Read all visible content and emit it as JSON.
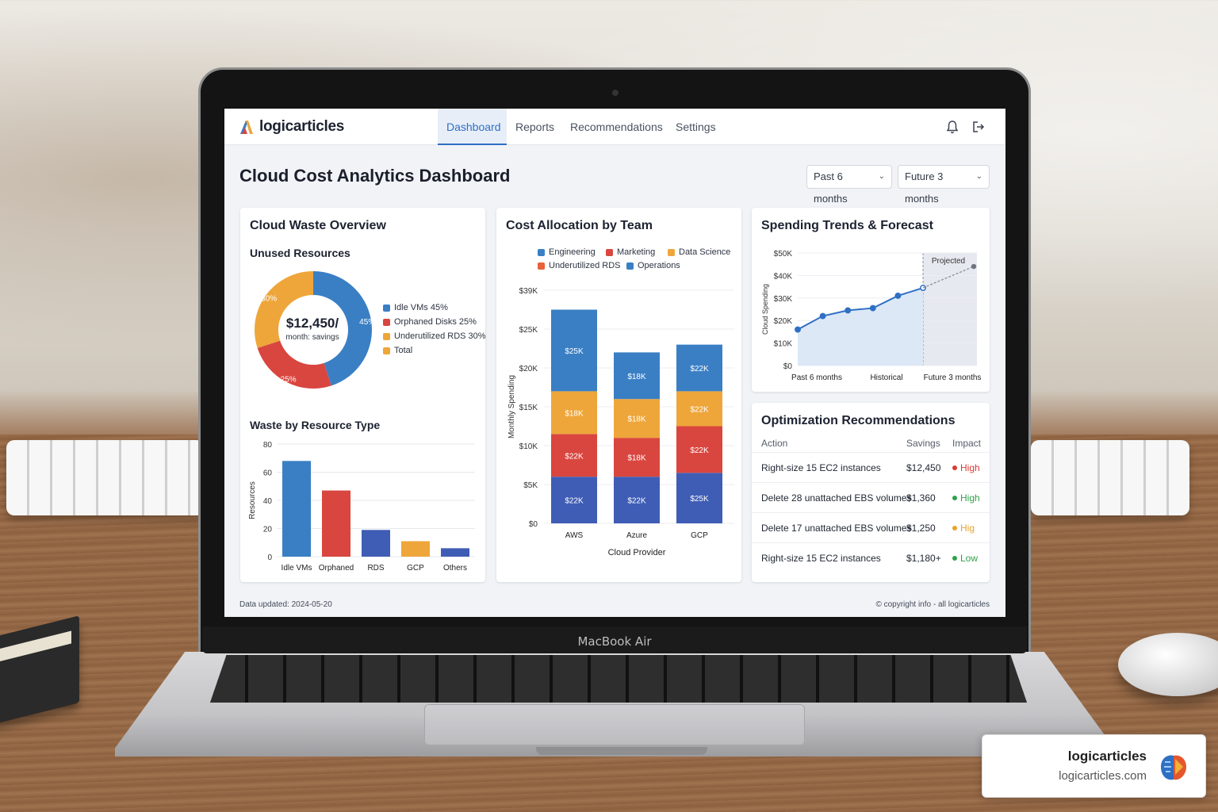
{
  "app": {
    "logo_text": "logicarticles",
    "nav_tabs": [
      {
        "label": "Dashboard",
        "active": true
      },
      {
        "label": "Reports",
        "active": false
      },
      {
        "label": "Recommendations",
        "active": false
      },
      {
        "label": "Settings",
        "active": false
      }
    ],
    "icons": [
      "bell-icon",
      "logout-icon"
    ]
  },
  "page": {
    "title": "Cloud Cost Analytics Dashboard",
    "filters": [
      {
        "value": "Past 6 months"
      },
      {
        "value": "Future 3 months"
      }
    ]
  },
  "waste_card": {
    "title": "Cloud Waste Overview",
    "donut_subtitle": "Unused Resources",
    "center_value": "$12,450/",
    "center_label": "month: savings",
    "bar_subtitle": "Waste by Resource Type"
  },
  "team_card": {
    "title": "Cost Allocation by Team"
  },
  "trend_card": {
    "title": "Spending Trends & Forecast"
  },
  "rec_card": {
    "title": "Optimization Recommendations",
    "columns": [
      "Action",
      "Savings",
      "Impact"
    ],
    "rows": [
      {
        "action": "Right-size 15 EC2 instances",
        "savings": "$12,450",
        "impact": "High",
        "impact_color": "#d93a35"
      },
      {
        "action": "Delete 28 unattached EBS volumes",
        "savings": "$1,360",
        "impact": "High",
        "impact_color": "#2fa14a"
      },
      {
        "action": "Delete 17 unattached EBS volumes",
        "savings": "$1,250",
        "impact": "Hig",
        "impact_color": "#e8a32c"
      },
      {
        "action": "Right-size 15 EC2 instances",
        "savings": "$1,180+",
        "impact": "Low",
        "impact_color": "#2fa14a"
      }
    ]
  },
  "footer": {
    "updated": "Data updated: 2024-05-20",
    "copyright": "© copyright info - all logicarticles"
  },
  "device": {
    "brand": "MacBook Air"
  },
  "watermark": {
    "name": "logicarticles",
    "url": "logicarticles.com"
  },
  "colors": {
    "blue": "#3a7fc4",
    "red": "#d9463f",
    "orange": "#eea63a",
    "navy": "#3f5db5",
    "accent": "#2f6fc4"
  },
  "chart_data": [
    {
      "type": "pie",
      "title": "Unused Resources",
      "slices": [
        {
          "label": "Idle VMs 45%",
          "value": 45,
          "slice_label": "45%",
          "color": "#3a7fc4"
        },
        {
          "label": "Orphaned Disks 25%",
          "value": 25,
          "slice_label": "25%",
          "color": "#d9463f"
        },
        {
          "label": "Underutilized RDS 30%",
          "value": 30,
          "slice_label": "30%",
          "color": "#eea63a"
        }
      ],
      "legend": [
        {
          "label": "Idle VMs 45%",
          "color": "#3a7fc4"
        },
        {
          "label": "Orphaned Disks 25%",
          "color": "#d9463f"
        },
        {
          "label": "Underutilized RDS 30%",
          "color": "#eea63a"
        },
        {
          "label": "Total",
          "color": "#eea63a"
        }
      ],
      "legend_position": "right"
    },
    {
      "type": "bar",
      "title": "Waste by Resource Type",
      "categories": [
        "Idle VMs",
        "Orphaned",
        "RDS",
        "GCP",
        "Others"
      ],
      "values": [
        68,
        47,
        19,
        11,
        6
      ],
      "colors": [
        "#3a7fc4",
        "#d9463f",
        "#3f5db5",
        "#eea63a",
        "#3f5db5"
      ],
      "ylabel": "Resources",
      "yticks": [
        "0",
        "20",
        "40",
        "60",
        "80"
      ],
      "ylim": [
        0,
        80
      ],
      "grid": true
    },
    {
      "type": "bar",
      "stacked": true,
      "title": "Cost Allocation by Team",
      "categories": [
        "AWS",
        "Azure",
        "GCP"
      ],
      "xlabel": "Cloud Provider",
      "ylabel": "Monthly Spending",
      "yticks": [
        "$0",
        "$5K",
        "$10K",
        "$15K",
        "$20K",
        "$25K",
        "$39K"
      ],
      "ylim": [
        0,
        30
      ],
      "series": [
        {
          "name": "Operations",
          "color": "#3f5db5",
          "values": [
            6,
            6,
            6.5
          ],
          "labels": [
            "$22K",
            "$22K",
            "$25K"
          ]
        },
        {
          "name": "Marketing",
          "color": "#d9463f",
          "values": [
            5.5,
            5,
            6
          ],
          "labels": [
            "$22K",
            "$18K",
            "$22K"
          ]
        },
        {
          "name": "Data Science",
          "color": "#eea63a",
          "values": [
            5.5,
            5,
            4.5
          ],
          "labels": [
            "$18K",
            "$18K",
            "$22K"
          ]
        },
        {
          "name": "Engineering",
          "color": "#3a7fc4",
          "values": [
            10.5,
            6,
            6
          ],
          "labels": [
            "$25K",
            "$18K",
            "$22K"
          ]
        }
      ],
      "legend": [
        {
          "label": "Engineering",
          "color": "#3a7fc4"
        },
        {
          "label": "Marketing",
          "color": "#d9463f"
        },
        {
          "label": "Data Science",
          "color": "#eea63a"
        },
        {
          "label": "Underutilized RDS",
          "color": "#e9603a"
        },
        {
          "label": "Operations",
          "color": "#3a7fc4"
        }
      ],
      "legend_position": "top"
    },
    {
      "type": "line",
      "title": "Spending Trends & Forecast",
      "ylabel": "Cloud Spending",
      "yticks": [
        "$0",
        "$10K",
        "$20K",
        "$30K",
        "$40K",
        "$50K"
      ],
      "ylim": [
        0,
        50
      ],
      "xlabels": [
        "Past 6 months",
        "Historical",
        "Future 3 months"
      ],
      "region_label": "Projected",
      "historical": [
        16,
        22,
        24.5,
        25.5,
        31,
        34.5
      ],
      "projected": [
        34.5,
        44
      ]
    }
  ]
}
